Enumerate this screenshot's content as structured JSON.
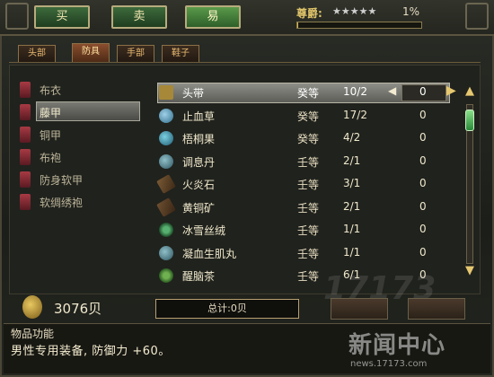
{
  "modes": [
    {
      "label": "买",
      "active": false
    },
    {
      "label": "卖",
      "active": false
    },
    {
      "label": "易",
      "active": true
    }
  ],
  "rank": {
    "label": "尊爵:",
    "stars": "★★★★★",
    "percent": "1%",
    "progress": 0.01
  },
  "subtabs": [
    {
      "label": "头部",
      "active": false
    },
    {
      "label": "防具",
      "active": true
    },
    {
      "label": "手部",
      "active": false
    },
    {
      "label": "鞋子",
      "active": false
    }
  ],
  "categories": [
    {
      "label": "布衣",
      "selected": false
    },
    {
      "label": "藤甲",
      "selected": true
    },
    {
      "label": "铜甲",
      "selected": false
    },
    {
      "label": "布袍",
      "selected": false
    },
    {
      "label": "防身软甲",
      "selected": false
    },
    {
      "label": "软绸绣袍",
      "selected": false
    }
  ],
  "items": [
    {
      "name": "头带",
      "grade": "癸等",
      "qty": "10/2",
      "count": "0",
      "icon": "helmet-icon",
      "selected": true
    },
    {
      "name": "止血草",
      "grade": "癸等",
      "qty": "17/2",
      "count": "0",
      "icon": "potion-icon"
    },
    {
      "name": "梧桐果",
      "grade": "癸等",
      "qty": "4/2",
      "count": "0",
      "icon": "fruit-icon"
    },
    {
      "name": "调息丹",
      "grade": "壬等",
      "qty": "2/1",
      "count": "0",
      "icon": "pill-icon"
    },
    {
      "name": "火炎石",
      "grade": "壬等",
      "qty": "3/1",
      "count": "0",
      "icon": "stone-icon"
    },
    {
      "name": "黄铜矿",
      "grade": "壬等",
      "qty": "2/1",
      "count": "0",
      "icon": "ore-icon"
    },
    {
      "name": "冰雪丝绒",
      "grade": "壬等",
      "qty": "1/1",
      "count": "0",
      "icon": "silk-icon"
    },
    {
      "name": "凝血生肌丸",
      "grade": "壬等",
      "qty": "1/1",
      "count": "0",
      "icon": "pill-icon"
    },
    {
      "name": "醒脑茶",
      "grade": "壬等",
      "qty": "6/1",
      "count": "0",
      "icon": "tea-icon"
    }
  ],
  "money": "3076贝",
  "total": "总计:0贝",
  "description": {
    "title": "物品功能",
    "text": "男性专用装备, 防御力 +60。"
  },
  "watermark": {
    "main": "新闻中心",
    "sub": "news.17173.com"
  }
}
